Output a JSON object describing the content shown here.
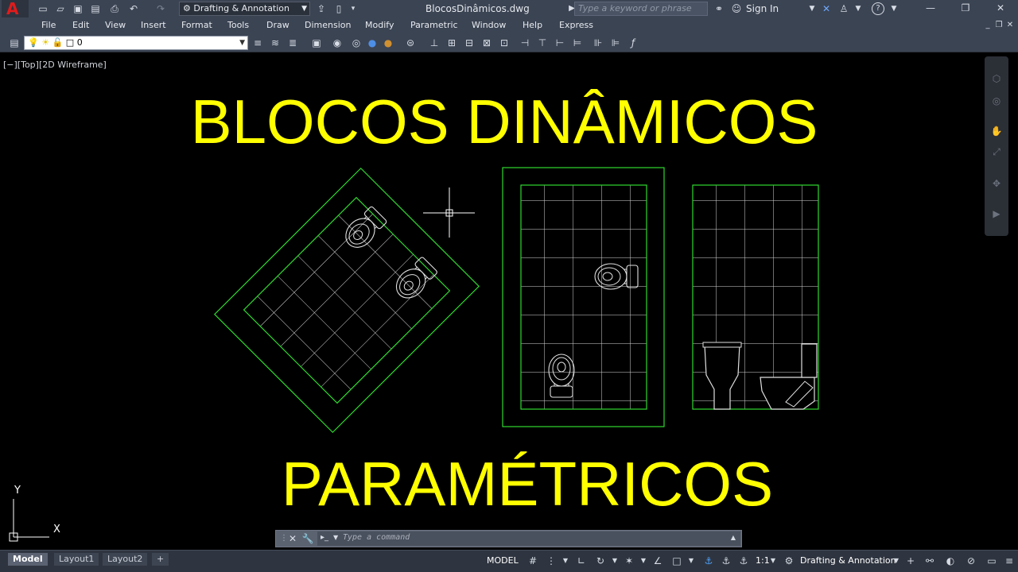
{
  "titlebar": {
    "workspace": "Drafting & Annotation",
    "file_name": "BlocosDinâmicos.dwg",
    "search_placeholder": "Type a keyword or phrase",
    "sign_in": "Sign In",
    "app_logo": "A"
  },
  "menu": [
    "File",
    "Edit",
    "View",
    "Insert",
    "Format",
    "Tools",
    "Draw",
    "Dimension",
    "Modify",
    "Parametric",
    "Window",
    "Help",
    "Express"
  ],
  "layer": {
    "current": "0"
  },
  "viewport": {
    "label": "[−][Top][2D Wireframe]"
  },
  "drawing": {
    "title_line1": "BLOCOS DINÂMICOS",
    "title_line2": "PARAMÉTRICOS",
    "text_color": "#ffff00",
    "line_color": "#2fd82f"
  },
  "ucs": {
    "x": "X",
    "y": "Y"
  },
  "command": {
    "placeholder": "Type a command"
  },
  "layout_tabs": [
    "Model",
    "Layout1",
    "Layout2"
  ],
  "status": {
    "model": "MODEL",
    "scale": "1:1",
    "workspace": "Drafting & Annotation"
  },
  "icons": [
    "quick-access-icons",
    "close-icon",
    "minimize-icon",
    "restore-icon",
    "help-icon",
    "binoculars-icon",
    "user-icon",
    "navigation-bar-icons"
  ]
}
